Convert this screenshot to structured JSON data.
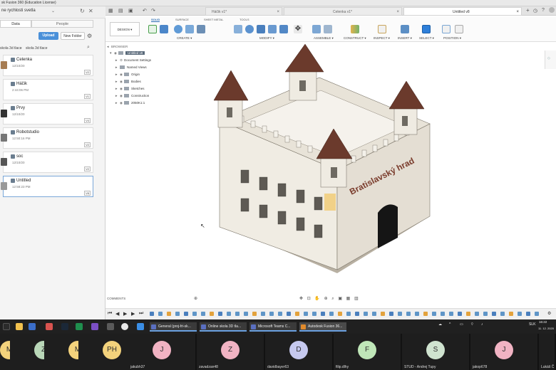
{
  "window": {
    "title": "sk Fusion 360 (Education License)"
  },
  "left_panel": {
    "project_dropdown": "ne rychlosti svetla",
    "tabs": [
      {
        "label": "Data"
      },
      {
        "label": "People"
      }
    ],
    "upload_label": "Upload",
    "new_folder_label": "New Folder",
    "breadcrumb": [
      "skola 3d tlace",
      "skola 3d tlace"
    ],
    "files": [
      {
        "name": "Celenka",
        "date": "12/10/20",
        "version": "V2"
      },
      {
        "name": "Háčik",
        "date": "2:44:06 PM",
        "version": "V1"
      },
      {
        "name": "Prvy",
        "date": "12/10/20",
        "version": "V4"
      },
      {
        "name": "Robotstudio",
        "date": "12:50:16 PM",
        "version": "V2"
      },
      {
        "name": "soc",
        "date": "12/10/20",
        "version": "V2"
      },
      {
        "name": "Untitled",
        "date": "12:58:23 PM",
        "version": "V8"
      }
    ]
  },
  "doc_tabs": [
    {
      "label": "Háčik v1*"
    },
    {
      "label": "Celenka v1*"
    },
    {
      "label": "Untitled v8"
    }
  ],
  "toolbar": {
    "design_label": "DESIGN ▾",
    "tabs": [
      {
        "label": "SOLID"
      },
      {
        "label": "SURFACE"
      },
      {
        "label": "SHEET METAL"
      },
      {
        "label": "TOOLS"
      }
    ],
    "groups": [
      {
        "label": "CREATE ▾"
      },
      {
        "label": "MODIFY ▾"
      },
      {
        "label": "ASSEMBLE ▾"
      },
      {
        "label": "CONSTRUCT ▾"
      },
      {
        "label": "INSPECT ▾"
      },
      {
        "label": "INSERT ▾"
      },
      {
        "label": "SELECT ▾"
      },
      {
        "label": "POSITION ▾"
      }
    ]
  },
  "browser": {
    "header": "BROWSER",
    "root": "Untitled v8",
    "items": [
      {
        "label": "Document Settings"
      },
      {
        "label": "Named Views"
      },
      {
        "label": "Origin"
      },
      {
        "label": "Bodies"
      },
      {
        "label": "Sketches"
      },
      {
        "label": "Construction"
      },
      {
        "label": "2050K1:1"
      }
    ]
  },
  "model": {
    "sign_text": "Bratislavský hrad"
  },
  "comments_label": "COMMENTS",
  "taskbar": {
    "apps": [
      {
        "label": "General (proj-fri-sk..."
      },
      {
        "label": "Online skola 3D tla..."
      },
      {
        "label": "Microsoft Teams C..."
      },
      {
        "label": "Autodesk Fusion 36..."
      }
    ],
    "lang": "SLK",
    "time": "16:22",
    "date": "11. 12. 2020"
  },
  "participants": [
    {
      "initials": "M",
      "name": "",
      "color": "#f3d27c"
    },
    {
      "initials": "Z",
      "name": "",
      "color": "#b9d7b8"
    },
    {
      "initials": "M",
      "name": "",
      "color": "#f3d27c"
    },
    {
      "initials": "PH",
      "name": "",
      "color": "#f3d27c"
    },
    {
      "initials": "J",
      "name": "jakubh37",
      "color": "#f1b3c3"
    },
    {
      "initials": "Z",
      "name": "zavadzan48",
      "color": "#f1b3c3"
    },
    {
      "initials": "D",
      "name": "davidbayer63",
      "color": "#c6c9ef"
    },
    {
      "initials": "F",
      "name": "filip.dlhy",
      "color": "#bfe6b8"
    },
    {
      "initials": "S",
      "name": "STUD - Andrej Tupy",
      "color": "#cfe3cf"
    },
    {
      "initials": "J",
      "name": "jakop678",
      "color": "#f1b3c3"
    },
    {
      "initials": "",
      "name": "Lukáš Č",
      "color": "#444444"
    }
  ]
}
